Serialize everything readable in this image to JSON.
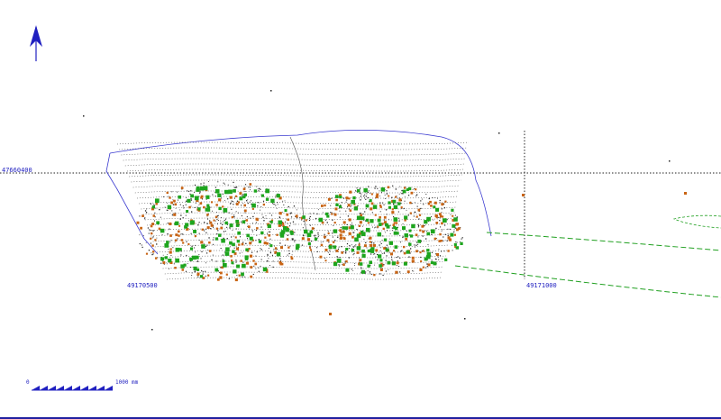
{
  "map": {
    "colors": {
      "background": "#ffffff",
      "grid_line": "#222222",
      "outline": "#3a3ad0",
      "contour": "#333333",
      "green_marker": "#1ea51e",
      "orange_marker": "#c86414",
      "green_line": "#20a020",
      "label": "#2020c0"
    },
    "north_arrow": {
      "icon": "north-arrow-icon"
    },
    "grid_labels": {
      "horizontal_line": "47660400",
      "vertical_left": "49170500",
      "vertical_right": "49171000"
    },
    "scale_bar": {
      "start_label": "0",
      "end_label": "1000 mm",
      "segments": 10
    }
  }
}
